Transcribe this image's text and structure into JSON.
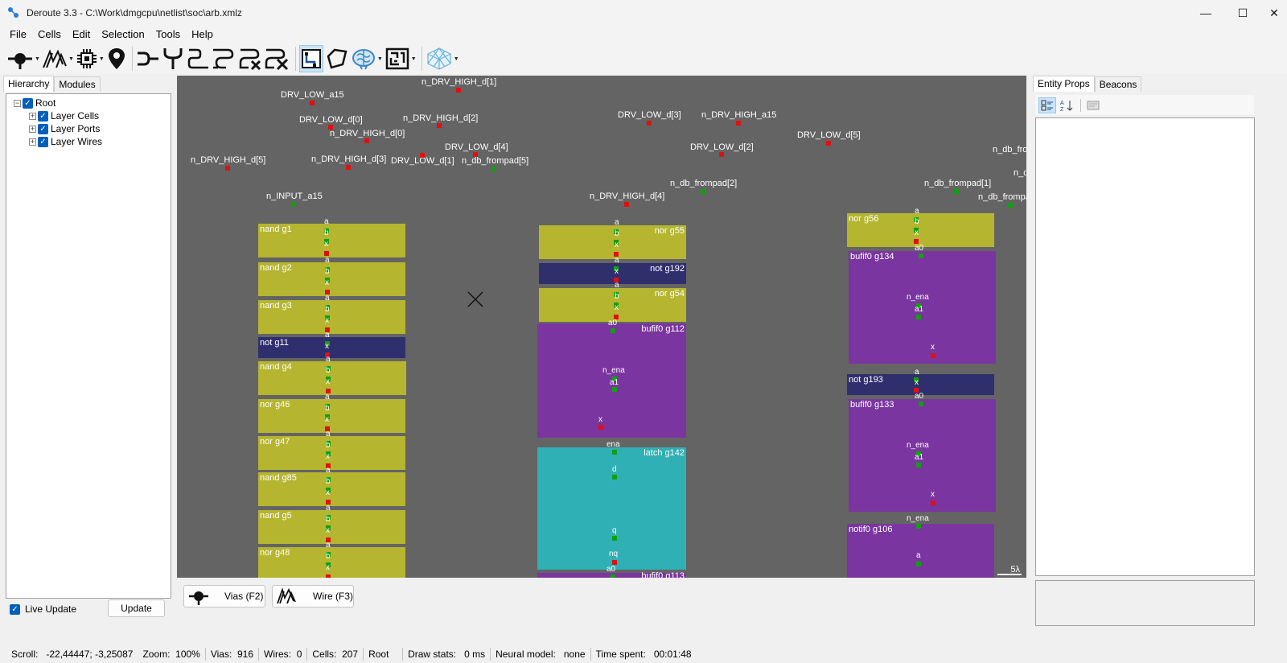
{
  "window": {
    "title": "Deroute 3.3 - C:\\Work\\dmgcpu\\netlist\\soc\\arb.xmlz",
    "minimize": "—",
    "maximize": "☐",
    "close": "✕"
  },
  "menu": [
    "File",
    "Cells",
    "Edit",
    "Selection",
    "Tools",
    "Help"
  ],
  "toolbar": {
    "icons": [
      "via-tool-icon",
      "wire-tool-icon",
      "cell-tool-icon",
      "beacon-pin-icon",
      "route-single-icon",
      "route-fork-icon",
      "route-bend-icon",
      "route-bend-double-icon",
      "delete-wires-icon",
      "delete-wires-all-icon",
      "select-rect-icon",
      "select-poly-icon",
      "neural-brain-icon",
      "layout-maze-icon",
      "crystal-icon"
    ]
  },
  "left_panel": {
    "tabs": [
      "Hierarchy",
      "Modules"
    ],
    "tree": {
      "root": {
        "label": "Root",
        "checked": true,
        "expanded": true
      },
      "children": [
        {
          "label": "Layer Cells",
          "checked": true
        },
        {
          "label": "Layer Ports",
          "checked": true
        },
        {
          "label": "Layer Wires",
          "checked": true
        }
      ]
    },
    "live_update_label": "Live Update",
    "live_update_checked": true,
    "update_button": "Update"
  },
  "canvas": {
    "background": "#646464",
    "labels": [
      "n_DRV_HIGH_d[1]",
      "DRV_LOW_a15",
      "DRV_LOW_d[0]",
      "n_DRV_HIGH_d[2]",
      "n_DRV_HIGH_d[0]",
      "DRV_LOW_d[4]",
      "n_DRV_HIGH_d[5]",
      "n_DRV_HIGH_d[3]",
      "DRV_LOW_d[1]",
      "n_db_frompad[5]",
      "n_INPUT_a15",
      "DRV_LOW_d[3]",
      "n_DRV_HIGH_a15",
      "DRV_LOW_d[5]",
      "DRV_LOW_d[2]",
      "n_db_frompad[2]",
      "n_DRV_HIGH_d[4]",
      "n_db_frompad[1]",
      "n_db_fro",
      "n_d",
      "n_db_frompa"
    ],
    "cells_col1": [
      "nand g1",
      "nand g2",
      "nand g3",
      "not g11",
      "nand g4",
      "nor g46",
      "nor g47",
      "nand g85",
      "nand g5",
      "nor g48"
    ],
    "cells_col2": [
      "nor g55",
      "not g192",
      "nor g54",
      "bufif0 g112",
      "latch g142",
      "bufif0 g113"
    ],
    "cells_col3": [
      "nor g56",
      "bufif0 g134",
      "not g193",
      "bufif0 g133",
      "notif0 g106"
    ],
    "pins": {
      "a": "a",
      "b": "b",
      "x": "x",
      "a0": "a0",
      "a1": "a1",
      "n_ena": "n_ena",
      "ena": "ena",
      "d": "d",
      "q": "q",
      "nq": "nq"
    },
    "scale": "5λ"
  },
  "mode_buttons": [
    {
      "label": "Vias (F2)",
      "icon": "via-tool-icon"
    },
    {
      "label": "Wire (F3)",
      "icon": "wire-tool-icon"
    }
  ],
  "right_panel": {
    "tabs": [
      "Entity Props",
      "Beacons"
    ],
    "toolbar_icons": [
      "categorized-icon",
      "alphabetical-sort-icon",
      "property-pages-icon"
    ]
  },
  "statusbar": {
    "scroll_label": "Scroll:",
    "scroll_value": "-22,44447; -3,25087",
    "zoom_label": "Zoom:",
    "zoom_value": "100%",
    "vias_label": "Vias:",
    "vias_value": "916",
    "wires_label": "Wires:",
    "wires_value": "0",
    "cells_label": "Cells:",
    "cells_value": "207",
    "module_value": "Root",
    "draw_label": "Draw stats:",
    "draw_value": "0 ms",
    "neural_label": "Neural model:",
    "neural_value": "none",
    "time_label": "Time spent:",
    "time_value": "00:01:48"
  },
  "colors": {
    "nand_nor": "#b5b530",
    "not": "#2f2f6e",
    "bufif": "#7a35a0",
    "latch": "#2fb0b5",
    "port_red": "#e01010",
    "port_green": "#10a010",
    "accent": "#005fb8"
  }
}
